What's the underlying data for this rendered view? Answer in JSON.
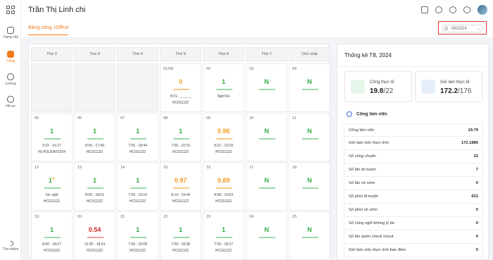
{
  "header": {
    "title": "Trần Thị Linh chi"
  },
  "sidebar": {
    "items": [
      {
        "label": "Trang chủ",
        "icon": "home-icon"
      },
      {
        "label": "Công",
        "icon": "calendar-icon"
      },
      {
        "label": "Lương",
        "icon": "dollar-icon"
      },
      {
        "label": "Hồ sơ",
        "icon": "user-icon"
      },
      {
        "label": "Thu nhỏm",
        "icon": "collapse-icon"
      }
    ]
  },
  "tab": {
    "label": "Bảng công 1Office"
  },
  "month_picker": {
    "value": "08/2024"
  },
  "calendar": {
    "weekdays": [
      "Thứ 2",
      "Thứ 3",
      "Thứ 4",
      "Thứ 5",
      "Thứ 6",
      "Thứ 7",
      "Chủ nhật"
    ],
    "cells": [
      {
        "day": "",
        "value": "",
        "line1": "",
        "line2": "",
        "empty": true
      },
      {
        "day": "",
        "value": "",
        "line1": "",
        "line2": "",
        "empty": true
      },
      {
        "day": "",
        "value": "",
        "line1": "",
        "line2": "",
        "empty": true
      },
      {
        "day": "01/08",
        "value": "0",
        "color": "o",
        "line1": "8:01 - _ _:_ _",
        "line2": "HC011122"
      },
      {
        "day": "02",
        "value": "1",
        "color": "g",
        "line1": "Nghỉ bù",
        "line1color": "g",
        "line2": ""
      },
      {
        "day": "03",
        "value": "N",
        "color": "g",
        "line1": "",
        "line2": ""
      },
      {
        "day": "04",
        "value": "N",
        "color": "g",
        "line1": "",
        "line2": ""
      },
      {
        "day": "05",
        "value": "1",
        "color": "g",
        "line1": "9:22 - 16:17",
        "line2": "HLHOLIDAY2024"
      },
      {
        "day": "06",
        "value": "1",
        "color": "g",
        "line1": "8:00 - 17:49",
        "line2": "HC011122"
      },
      {
        "day": "07",
        "value": "1",
        "color": "g",
        "line1": "7:55 - 18:44",
        "line2": "HC011122"
      },
      {
        "day": "08",
        "value": "1",
        "color": "g",
        "line1": "7:56 - 22:16",
        "line2": "HC011122"
      },
      {
        "day": "09",
        "value": "0.96",
        "color": "o",
        "line1": "8:21 - 19:29",
        "line2": "HC011122"
      },
      {
        "day": "10",
        "value": "N",
        "color": "g",
        "line1": "",
        "line2": ""
      },
      {
        "day": "11",
        "value": "N",
        "color": "g",
        "line1": "",
        "line2": ""
      },
      {
        "day": "12",
        "value": "1",
        "color": "g",
        "line1": "Xin nghỉ",
        "line1color": "g",
        "line2": "HC011122",
        "star": true
      },
      {
        "day": "13",
        "value": "1",
        "color": "g",
        "line1": "8:00 - 18:01",
        "line2": "HC011122"
      },
      {
        "day": "14",
        "value": "1",
        "color": "g",
        "line1": "7:59 - 19:14",
        "line2": "HC011122"
      },
      {
        "day": "15",
        "value": "0.97",
        "color": "o",
        "line1": "8:14 - 19:44",
        "line2": "HC011122"
      },
      {
        "day": "16",
        "value": "0.89",
        "color": "o",
        "line1": "8:58 - 19:53",
        "line2": "HC011122"
      },
      {
        "day": "17",
        "value": "N",
        "color": "g",
        "line1": "",
        "line2": ""
      },
      {
        "day": "18",
        "value": "N",
        "color": "g",
        "line1": "",
        "line2": ""
      },
      {
        "day": "19",
        "value": "1",
        "color": "g",
        "line1": "8:00 - 18:27",
        "line2": "HC011122"
      },
      {
        "day": "20",
        "value": "0.54",
        "color": "r",
        "line1": "12:00 - 18:24",
        "line1color": "r",
        "line2": "HC011122"
      },
      {
        "day": "21",
        "value": "1",
        "color": "g",
        "line1": "7:55 - 18:08",
        "line2": "HC011122"
      },
      {
        "day": "22",
        "value": "1",
        "color": "g",
        "line1": "7:59 - 18:38",
        "line2": "HC011122"
      },
      {
        "day": "23",
        "value": "1",
        "color": "g",
        "line1": "7:59 - 18:37",
        "line2": "HC011122"
      },
      {
        "day": "24",
        "value": "N",
        "color": "g",
        "line1": "",
        "line2": ""
      },
      {
        "day": "25",
        "value": "N",
        "color": "g",
        "line1": "",
        "line2": ""
      }
    ]
  },
  "stats": {
    "title": "Thống kê T8, 2024",
    "box1": {
      "label": "Công thực tế",
      "value": "19.8",
      "total": "/22",
      "color": "#e7f6ea"
    },
    "box2": {
      "label": "Giờ làm thực tế",
      "value": "172.2",
      "total": "/176",
      "color": "#e6eefb"
    },
    "section": "Công làm việc",
    "rows": [
      {
        "k": "Công làm việc",
        "v": "19.79"
      },
      {
        "k": "Giờ làm việc thực tính",
        "v": "172.1886"
      },
      {
        "k": "Số công chuẩn",
        "v": "22"
      },
      {
        "k": "Số lần đi muộn",
        "v": "7"
      },
      {
        "k": "Số lần về sớm",
        "v": "0"
      },
      {
        "k": "Số phút đi muộn",
        "v": "631"
      },
      {
        "k": "Số phút về sớm",
        "v": "0"
      },
      {
        "k": "Số công nghỉ không lý do",
        "v": "0"
      },
      {
        "k": "Số lần quên check in/out",
        "v": "0"
      },
      {
        "k": "Giờ làm việc thực tính ban đêm",
        "v": "0"
      }
    ]
  }
}
